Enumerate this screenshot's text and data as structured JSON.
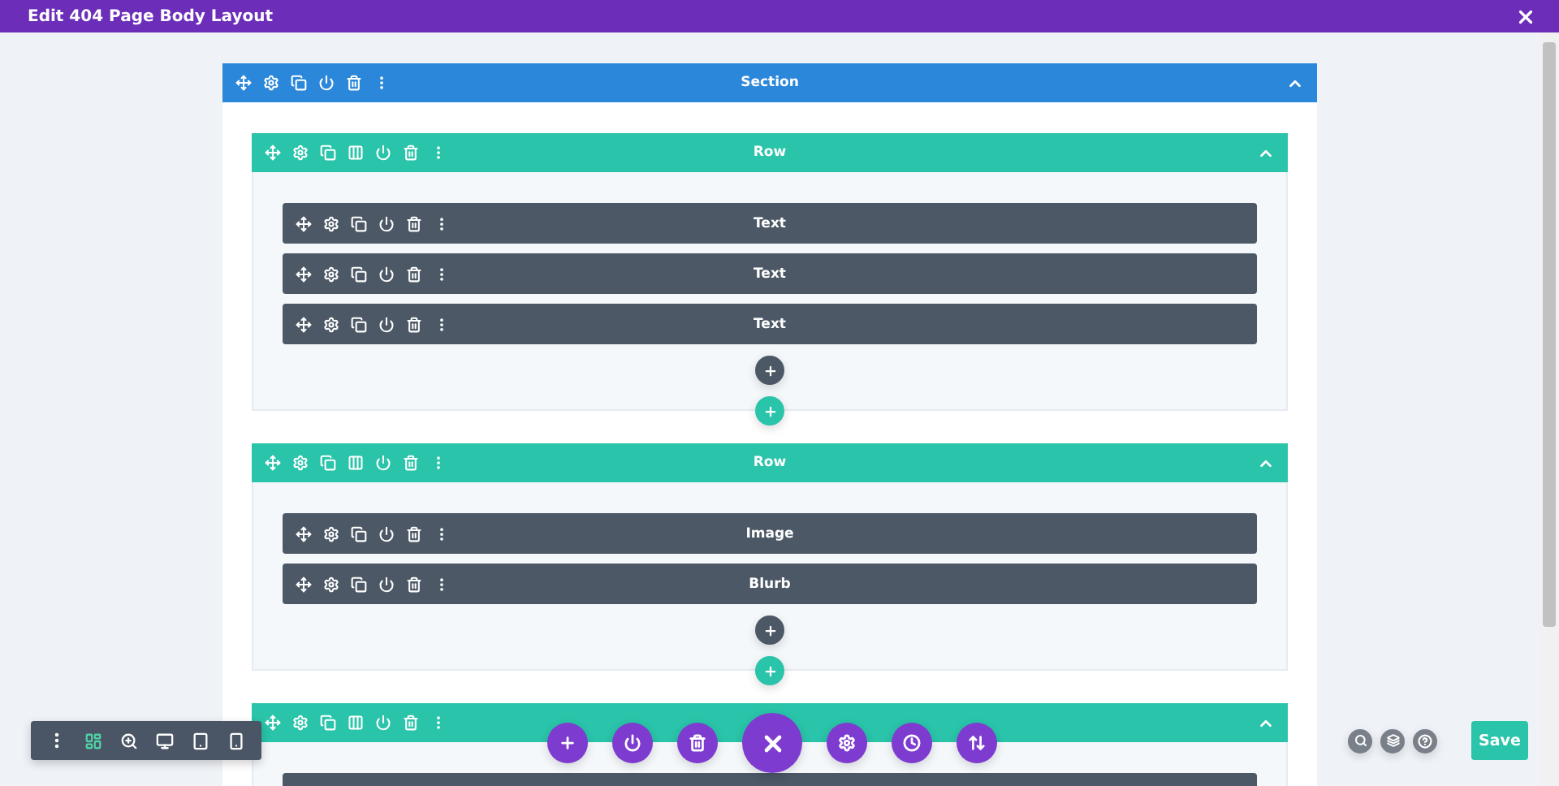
{
  "window": {
    "title": "Edit 404 Page Body Layout"
  },
  "section": {
    "title": "Section",
    "expanded": true,
    "rows": [
      {
        "title": "Row",
        "expanded": true,
        "modules": [
          {
            "kind": "module",
            "title": "Text"
          },
          {
            "kind": "module",
            "title": "Text"
          },
          {
            "kind": "module",
            "title": "Text"
          }
        ]
      },
      {
        "title": "Row",
        "expanded": true,
        "modules": [
          {
            "kind": "module",
            "title": "Image"
          },
          {
            "kind": "module",
            "title": "Blurb"
          }
        ]
      },
      {
        "expanded": true,
        "modules": [
          {
            "kind": "module_edge"
          }
        ]
      }
    ]
  },
  "view_toolbar": {
    "items": [
      {
        "kind": "wireframe",
        "selected": true
      },
      {
        "kind": "zoom",
        "selected": false
      },
      {
        "kind": "desktop",
        "selected": false
      },
      {
        "kind": "tablet",
        "selected": false
      },
      {
        "kind": "phone",
        "selected": false
      }
    ]
  },
  "save_button": {
    "label": "Save"
  }
}
